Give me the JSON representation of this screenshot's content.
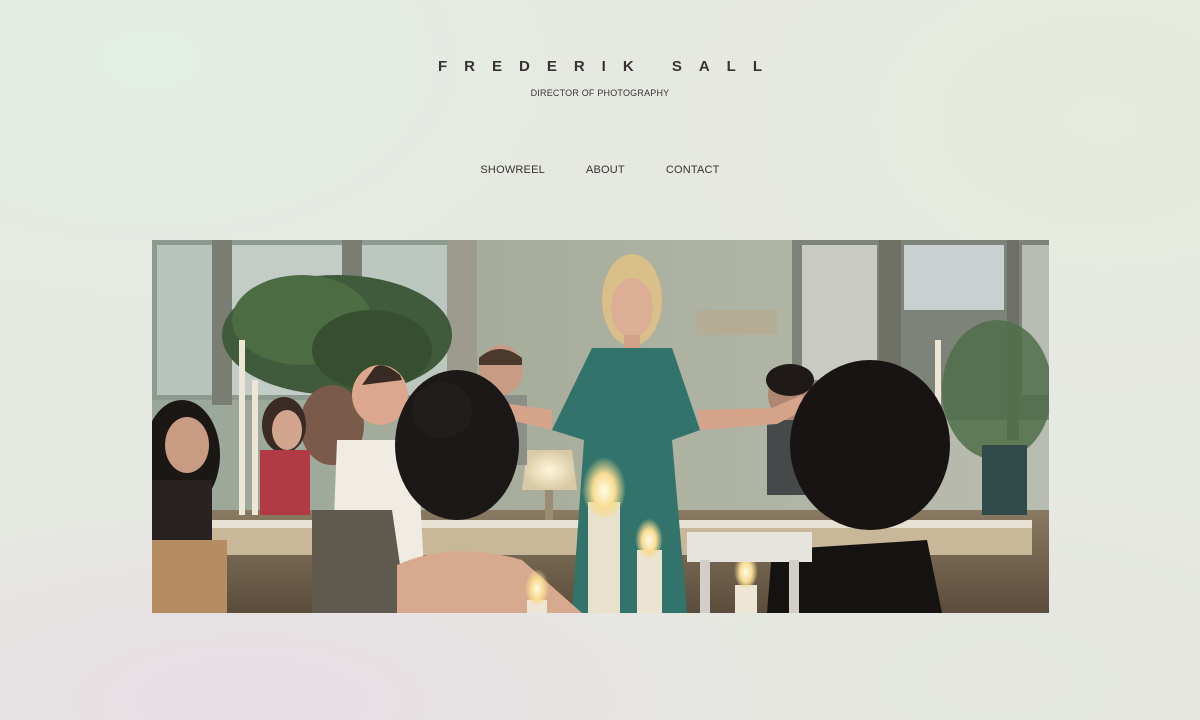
{
  "header": {
    "title": "FREDERIK SALL",
    "subtitle": "DIRECTOR OF PHOTOGRAPHY"
  },
  "nav": {
    "items": [
      {
        "label": "SHOWREEL"
      },
      {
        "label": "ABOUT"
      },
      {
        "label": "CONTACT"
      }
    ]
  },
  "hero": {
    "scene": "woman in green dress standing at dinner table with guests and candles"
  },
  "colors": {
    "text": "#3a3331",
    "background": "#e6e8e2",
    "dress": "#2f6e66"
  }
}
